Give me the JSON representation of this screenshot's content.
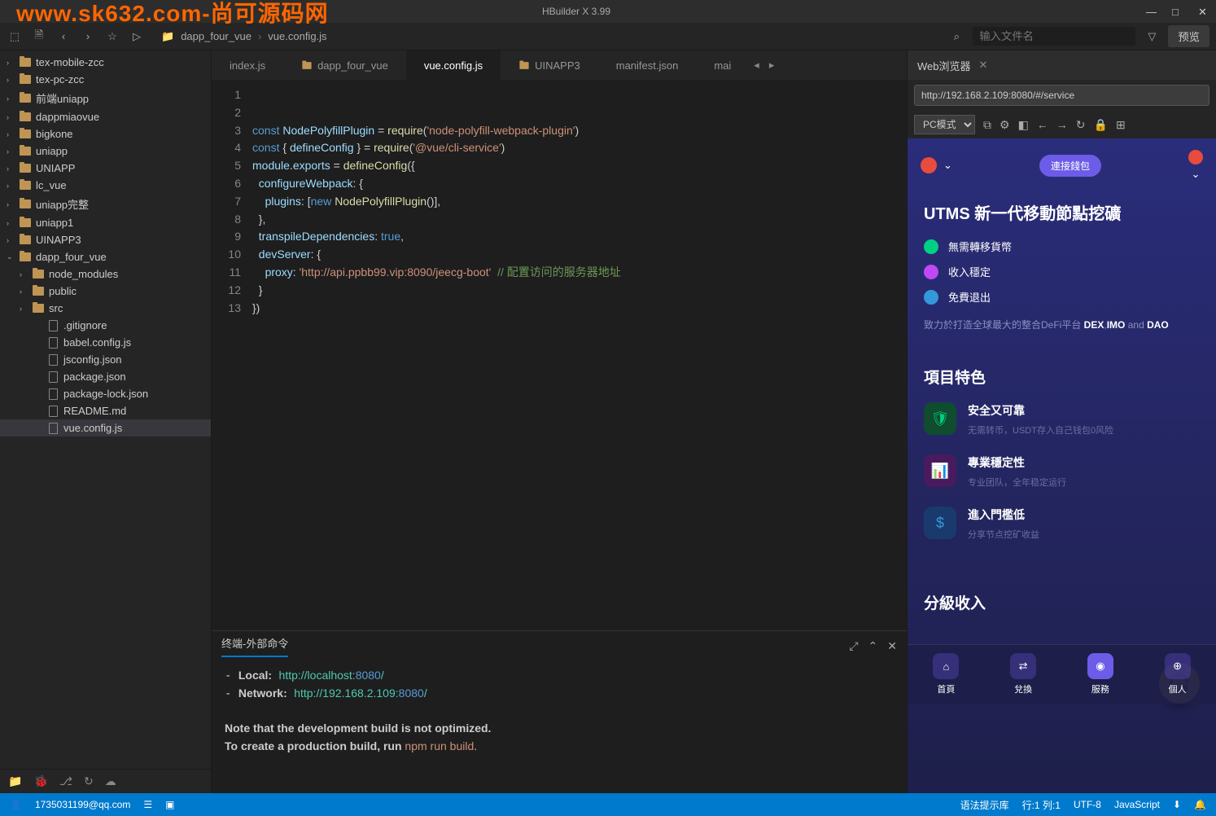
{
  "watermark": "www.sk632.com-尚可源码网",
  "title": "HBuilder X 3.99",
  "breadcrumb": {
    "folder": "dapp_four_vue",
    "file": "vue.config.js"
  },
  "search_placeholder": "输入文件名",
  "preview_btn": "预览",
  "sidebar": {
    "items": [
      {
        "label": "tex-mobile-zcc",
        "type": "folder",
        "arrow": "›"
      },
      {
        "label": "tex-pc-zcc",
        "type": "folder",
        "arrow": "›"
      },
      {
        "label": "前端uniapp",
        "type": "folder",
        "arrow": "›"
      },
      {
        "label": "dappmiaovue",
        "type": "folder",
        "arrow": "›"
      },
      {
        "label": "bigkone",
        "type": "folder",
        "arrow": "›"
      },
      {
        "label": "uniapp",
        "type": "folder",
        "arrow": "›"
      },
      {
        "label": "UNIAPP",
        "type": "folder",
        "arrow": "›"
      },
      {
        "label": "lc_vue",
        "type": "folder",
        "arrow": "›"
      },
      {
        "label": "uniapp完整",
        "type": "folder",
        "arrow": "›"
      },
      {
        "label": "uniapp1",
        "type": "folder",
        "arrow": "›"
      },
      {
        "label": "UINAPP3",
        "type": "folder",
        "arrow": "›"
      },
      {
        "label": "dapp_four_vue",
        "type": "folder",
        "arrow": "⌄",
        "expanded": true
      }
    ],
    "sub": [
      {
        "label": "node_modules",
        "type": "folder",
        "arrow": "›"
      },
      {
        "label": "public",
        "type": "folder",
        "arrow": "›"
      },
      {
        "label": "src",
        "type": "folder",
        "arrow": "›"
      },
      {
        "label": ".gitignore",
        "type": "file"
      },
      {
        "label": "babel.config.js",
        "type": "file"
      },
      {
        "label": "jsconfig.json",
        "type": "file"
      },
      {
        "label": "package.json",
        "type": "file"
      },
      {
        "label": "package-lock.json",
        "type": "file"
      },
      {
        "label": "README.md",
        "type": "file"
      },
      {
        "label": "vue.config.js",
        "type": "file",
        "active": true
      }
    ]
  },
  "tabs": [
    {
      "label": "index.js"
    },
    {
      "label": "dapp_four_vue",
      "icon": "folder"
    },
    {
      "label": "vue.config.js",
      "active": true
    },
    {
      "label": "UINAPP3",
      "icon": "folder"
    },
    {
      "label": "manifest.json"
    },
    {
      "label": "mai"
    }
  ],
  "code_lines": [
    "1",
    "2",
    "3",
    "4",
    "5",
    "6",
    "7",
    "8",
    "9",
    "10",
    "11",
    "12",
    "13"
  ],
  "code": {
    "l2_var": "NodePolyfillPlugin",
    "l2_str": "'node-polyfill-webpack-plugin'",
    "l3_var": "defineConfig",
    "l3_str": "'@vue/cli-service'",
    "l5": "configureWebpack",
    "l6": "plugins",
    "l6_class": "NodePolyfillPlugin",
    "l9": "transpileDependencies",
    "l10": "devServer",
    "l11": "proxy",
    "l11_str": "'http://api.ppbb99.vip:8090/jeecg-boot'",
    "l11_cm": "// 配置访问的服务器地址"
  },
  "terminal": {
    "title": "终端-外部命令",
    "local_label": "Local:",
    "local_url": "http://localhost:",
    "local_port": "8080",
    "local_slash": "/",
    "net_label": "Network:",
    "net_url": "http://192.168.2.109:",
    "net_port": "8080",
    "net_slash": "/",
    "note1": "Note that the development build is not optimized.",
    "note2_pre": "To create a production build, run ",
    "note2_cmd": "npm run build",
    "note2_post": "."
  },
  "browser": {
    "tab": "Web浏览器",
    "url": "http://192.168.2.109:8080/#/service",
    "mode": "PC模式",
    "connect": "連接錢包",
    "hero_title": "UTMS 新一代移動節點挖礦",
    "points": [
      "無需轉移貨幣",
      "收入穩定",
      "免費退出"
    ],
    "desc_pre": "致力於打造全球最大的整合DeFi平台 ",
    "desc_b1": "DEX",
    "desc_sep1": ",",
    "desc_b2": "IMO",
    "desc_and": "and ",
    "desc_b3": "DAO",
    "feat_title": "項目特色",
    "feats": [
      {
        "title": "安全又可靠",
        "desc": "无需转币，USDT存入自己钱包0风险"
      },
      {
        "title": "專業穩定性",
        "desc": "专业团队，全年稳定运行"
      },
      {
        "title": "進入門檻低",
        "desc": "分享节点挖矿收益"
      }
    ],
    "tier_title": "分級收入",
    "nav": [
      "首頁",
      "兌換",
      "服務",
      "個人"
    ]
  },
  "status": {
    "user": "1735031199@qq.com",
    "syntax": "语法提示库",
    "pos": "行:1 列:1",
    "enc": "UTF-8",
    "lang": "JavaScript"
  }
}
